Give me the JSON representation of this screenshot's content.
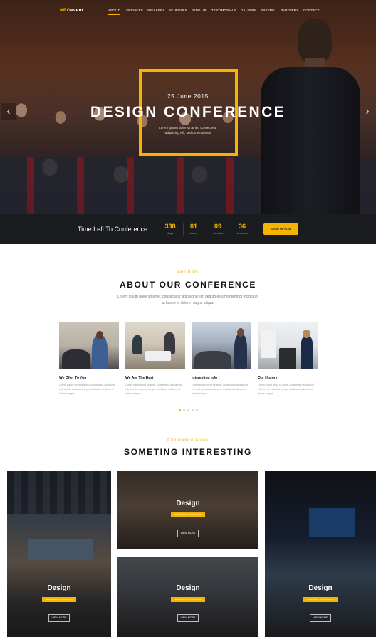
{
  "brand": {
    "logo_main": "NRG",
    "logo_suffix": "event"
  },
  "nav": [
    "ABOUT",
    "SERVICES",
    "SPEAKERS",
    "SCHEDULE",
    "SING UP",
    "TESTIMONIALS",
    "GALLERY",
    "PRICING",
    "PARTNERS",
    "CONTACT"
  ],
  "hero": {
    "date": "25 June 2015",
    "title": "DESIGN CONFERENCE",
    "subtitle": "Lorem ipsum dolor sit amet, consectetur adipiscing elit, sed do eiusmode",
    "prev_icon": "chevron-left-icon",
    "next_icon": "chevron-right-icon"
  },
  "countdown": {
    "label": "Time Left To Conference:",
    "units": [
      {
        "value": "338",
        "label": "days"
      },
      {
        "value": "01",
        "label": "hours"
      },
      {
        "value": "09",
        "label": "minutes"
      },
      {
        "value": "36",
        "label": "seconds"
      }
    ],
    "button": "SIGNE UP NOW"
  },
  "about": {
    "eyebrow": "About Us",
    "title": "ABOUT OUR CONFERENCE",
    "text": "Lorem ipsum dolor sit amet, consectetur adipiscing elit, sed do eiusmod tempor incididunt ut labore et dolore magna aliqua.",
    "cards": [
      {
        "title": "We Offer To You",
        "text": "Lorem ipsum dolor sit amet, consectetur adipiscing elit, sed do eiusmod tempor incididunt ut labore et dolore magna"
      },
      {
        "title": "We Are The Best",
        "text": "Lorem ipsum dolor sit amet, consectetur adipiscing elit, sed do eiusmod tempor incididunt ut labore et dolore magna"
      },
      {
        "title": "Interesting Info",
        "text": "Lorem ipsum dolor sit amet, consectetur adipiscing elit, sed do eiusmod tempor incididunt ut labore et dolore magna"
      },
      {
        "title": "Our History",
        "text": "Lorem ipsum dolor sit amet, consectetur adipiscing elit, sed do eiusmod tempor incididunt ut labore et dolore magna"
      }
    ]
  },
  "areas": {
    "eyebrow": "Conference Areas",
    "title": "SOMETING INTERESTING",
    "tiles": [
      {
        "title": "Design",
        "badge": "SPEAKERS: 34 SESSIONS",
        "button": "VIEW MORE"
      },
      {
        "title": "Design",
        "badge": "SPEAKERS: 34 SESSIONS",
        "button": "VIEW MORE"
      },
      {
        "title": "Design",
        "badge": "SPEAKERS: 34 SESSIONS",
        "button": "VIEW MORE"
      },
      {
        "title": "Design",
        "badge": "SPEAKERS: 34 SESSIONS",
        "button": "VIEW MORE"
      }
    ]
  },
  "colors": {
    "accent": "#f5b400",
    "dark": "#1b1c20"
  }
}
